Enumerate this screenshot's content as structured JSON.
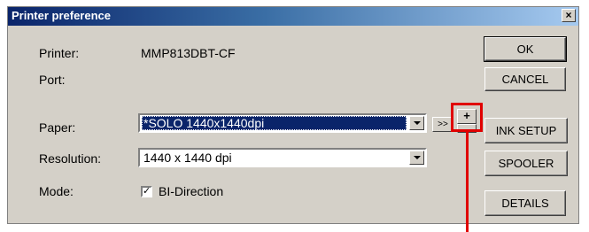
{
  "dialog": {
    "title": "Printer preference",
    "close_label": "×",
    "printer_label": "Printer:",
    "printer_value": "MMP813DBT-CF",
    "port_label": "Port:",
    "paper_label": "Paper:",
    "paper_value": "*SOLO 1440x1440dpi",
    "resolution_label": "Resolution:",
    "resolution_value": "1440 x 1440 dpi",
    "mode_label": "Mode:",
    "mode_checkbox_label": "BI-Direction",
    "mode_checked": true,
    "nav_next_label": ">>",
    "add_label": "+",
    "buttons": {
      "ok": "OK",
      "cancel": "CANCEL",
      "ink_setup": "INK SETUP",
      "spooler": "SPOOLER",
      "details": "DETAILS"
    }
  },
  "annotation": {
    "color": "#e00000"
  }
}
